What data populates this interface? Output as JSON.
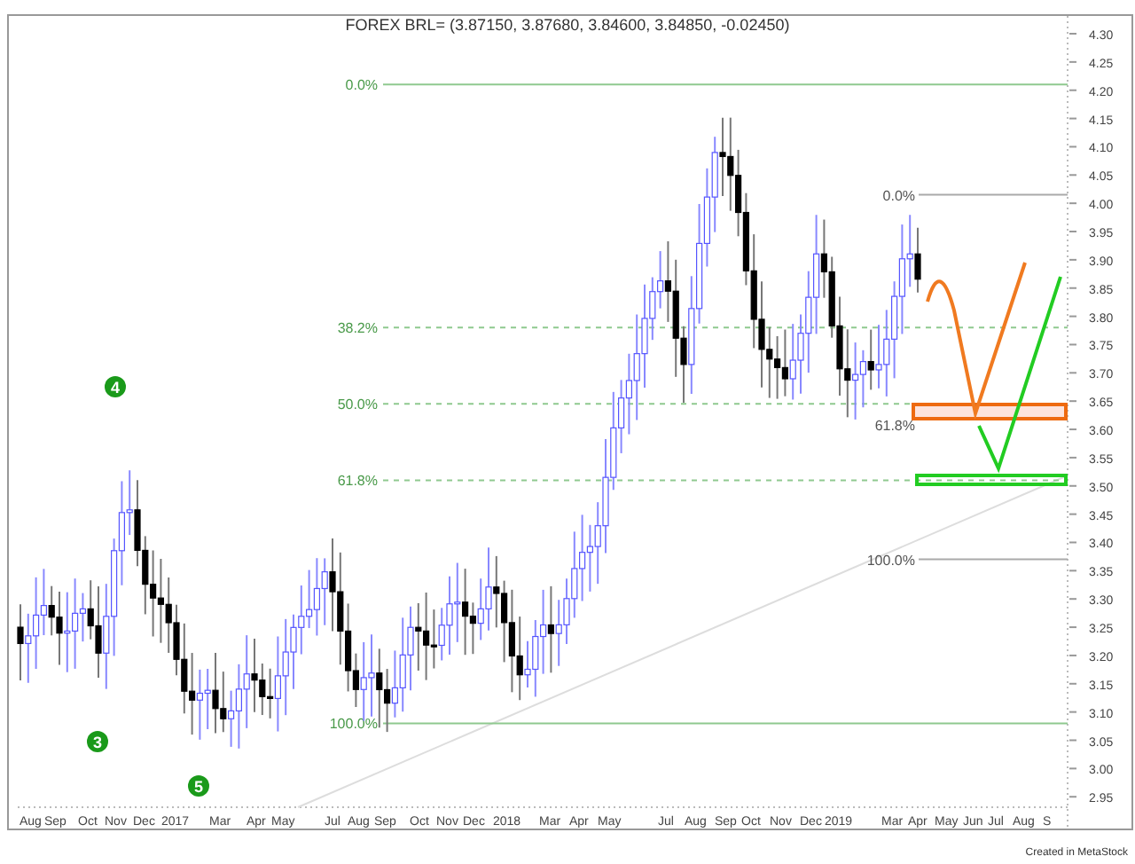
{
  "chart": {
    "title": "FOREX BRL= (3.87150, 3.87680, 3.84600, 3.84850, -0.02450)",
    "y_axis_labels": [
      "4.30",
      "4.25",
      "4.20",
      "4.15",
      "4.10",
      "4.05",
      "4.00",
      "3.95",
      "3.90",
      "3.85",
      "3.80",
      "3.75",
      "3.70",
      "3.65",
      "3.60",
      "3.55",
      "3.50",
      "3.45",
      "3.40",
      "3.35",
      "3.30",
      "3.25",
      "3.20",
      "3.15",
      "3.10",
      "3.05",
      "3.00",
      "2.95"
    ],
    "x_axis_labels": [
      "Aug",
      "Sep",
      "Oct",
      "Nov",
      "Dec",
      "2017",
      "Mar",
      "Apr",
      "May",
      "Jul",
      "Aug",
      "Sep",
      "Oct",
      "Nov",
      "Dec",
      "2018",
      "Mar",
      "Apr",
      "May",
      "Jul",
      "Aug",
      "Sep",
      "Oct",
      "Nov",
      "Dec",
      "2019",
      "Mar",
      "Apr",
      "May",
      "Jun",
      "Jul",
      "Aug",
      "S"
    ],
    "fibonacci_primary": [
      {
        "label": "0.0%"
      },
      {
        "label": "38.2%"
      },
      {
        "label": "50.0%"
      },
      {
        "label": "61.8%"
      },
      {
        "label": "100.0%"
      }
    ],
    "fibonacci_secondary": [
      {
        "label": "0.0%"
      },
      {
        "label": "61.8%"
      },
      {
        "label": "100.0%"
      }
    ],
    "wave_markers": [
      "4",
      "3",
      "5"
    ]
  },
  "footer": "Created in MetaStock"
}
